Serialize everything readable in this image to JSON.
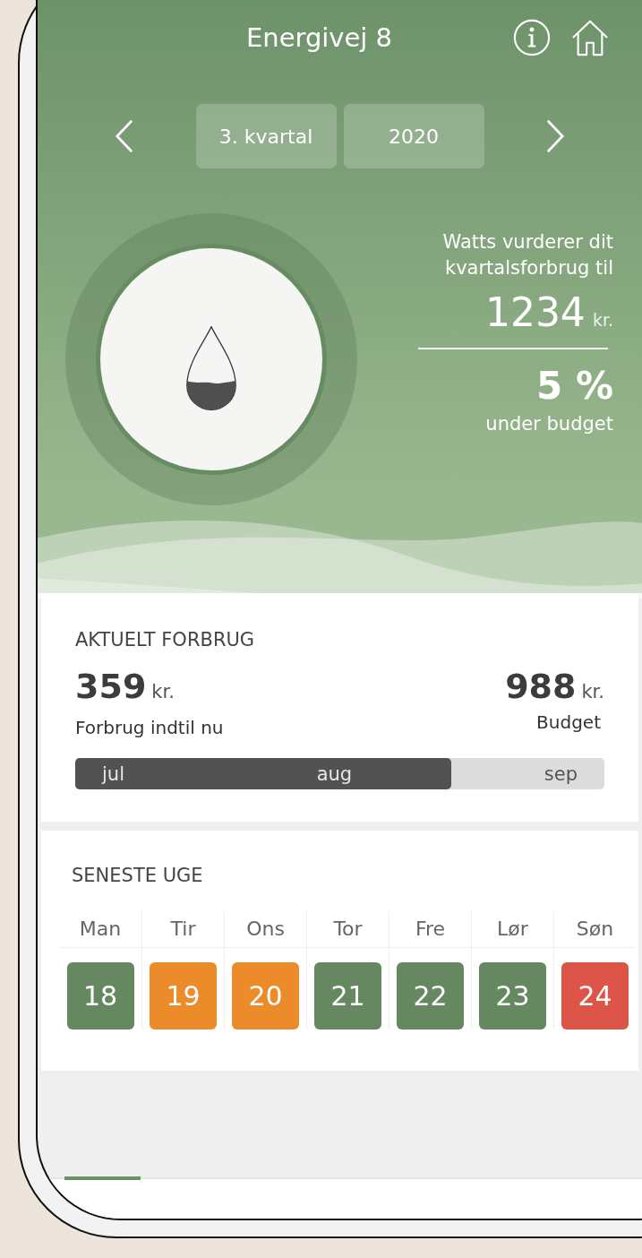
{
  "header": {
    "title": "Energivej 8"
  },
  "period": {
    "quarter": "3. kvartal",
    "year": "2020"
  },
  "estimate": {
    "intro": "Watts vurderer dit kvartalsforbrug til",
    "amount": "1234",
    "unit": "kr.",
    "percent": "5 %",
    "status": "under budget",
    "level": 0.36
  },
  "current_usage": {
    "title": "AKTUELT FORBRUG",
    "spent": {
      "amount": "359",
      "unit": "kr.",
      "label": "Forbrug indtil nu"
    },
    "budget": {
      "amount": "988",
      "unit": "kr.",
      "label": "Budget"
    },
    "months": [
      "jul",
      "aug",
      "sep"
    ],
    "level": 0.71
  },
  "last_week": {
    "title": "SENESTE UGE",
    "days": [
      {
        "name": "Man",
        "date": "18",
        "color": "#658860"
      },
      {
        "name": "Tir",
        "date": "19",
        "color": "#eb8b2a"
      },
      {
        "name": "Ons",
        "date": "20",
        "color": "#eb8b2a"
      },
      {
        "name": "Tor",
        "date": "21",
        "color": "#658860"
      },
      {
        "name": "Fre",
        "date": "22",
        "color": "#658860"
      },
      {
        "name": "Lør",
        "date": "23",
        "color": "#658860"
      },
      {
        "name": "Søn",
        "date": "24",
        "color": "#dc5548"
      }
    ]
  }
}
